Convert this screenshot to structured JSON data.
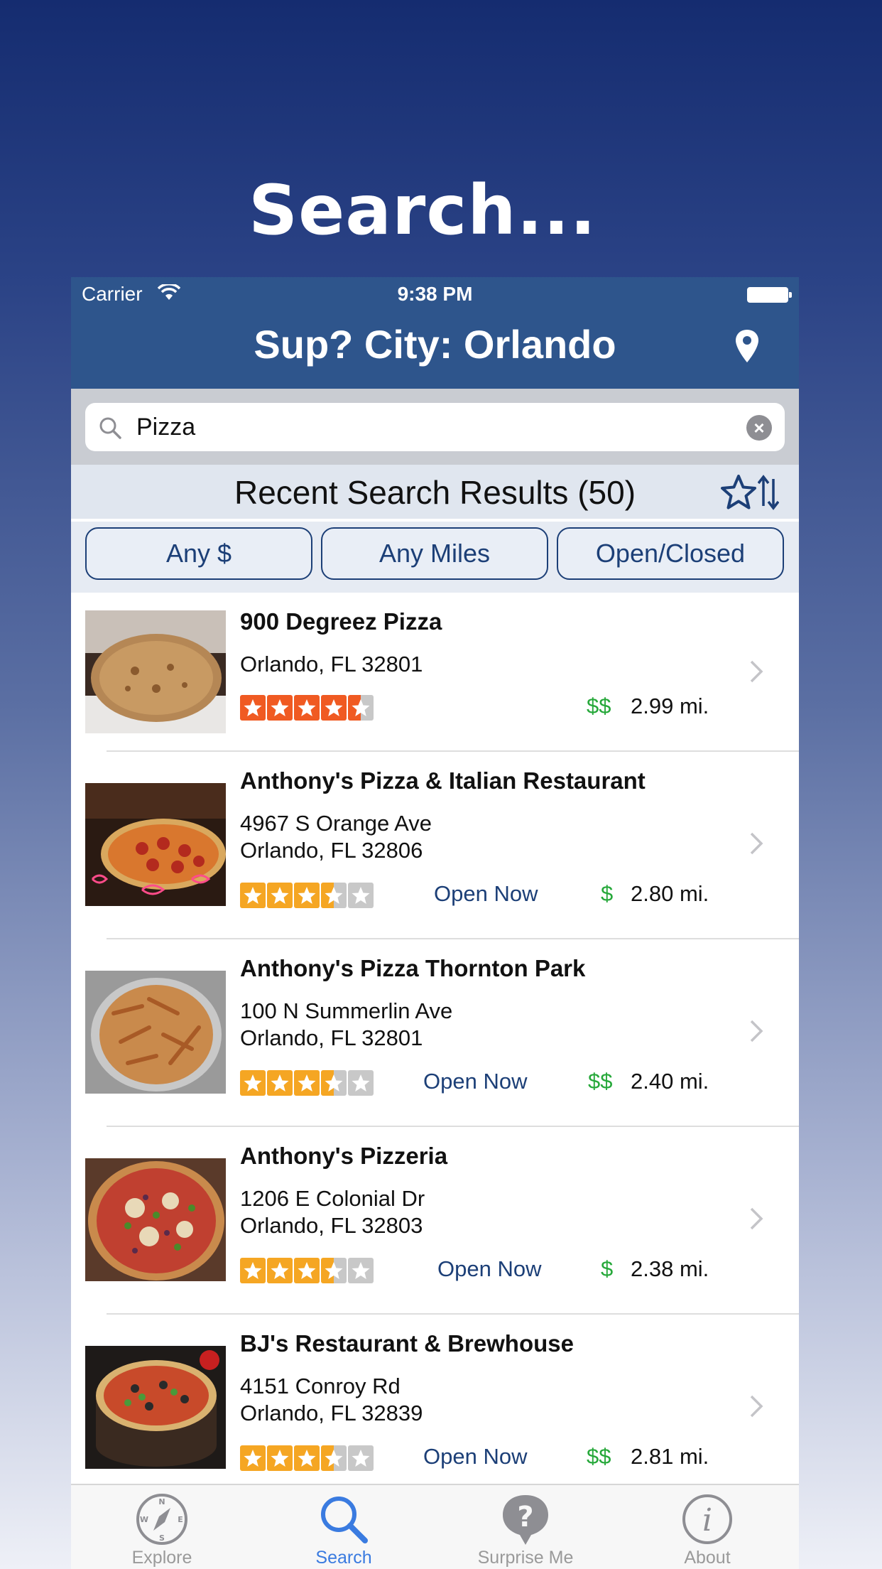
{
  "promo": {
    "title": "Search..."
  },
  "status_bar": {
    "carrier": "Carrier",
    "time": "9:38 PM"
  },
  "nav": {
    "title": "Sup? City:  Orlando",
    "location_icon": "map-pin-icon"
  },
  "search": {
    "value": "Pizza",
    "placeholder": ""
  },
  "results": {
    "title": "Recent Search Results (50)"
  },
  "filters": [
    {
      "label": "Any $"
    },
    {
      "label": "Any Miles"
    },
    {
      "label": "Open/Closed"
    }
  ],
  "restaurants": [
    {
      "name": "900 Degreez Pizza",
      "address_line1": "Orlando, FL 32801",
      "address_line2": "",
      "rating": 4.5,
      "open_status": "",
      "price": "$$",
      "distance": "2.99 mi."
    },
    {
      "name": "Anthony's Pizza & Italian Restaurant",
      "address_line1": "4967 S Orange Ave",
      "address_line2": "Orlando, FL 32806",
      "rating": 3.5,
      "open_status": "Open Now",
      "price": "$",
      "distance": "2.80 mi."
    },
    {
      "name": "Anthony's Pizza Thornton Park",
      "address_line1": "100 N Summerlin Ave",
      "address_line2": "Orlando, FL 32801",
      "rating": 3.5,
      "open_status": "Open Now",
      "price": "$$",
      "distance": "2.40 mi."
    },
    {
      "name": "Anthony's Pizzeria",
      "address_line1": "1206 E Colonial Dr",
      "address_line2": "Orlando, FL 32803",
      "rating": 3.5,
      "open_status": "Open Now",
      "price": "$",
      "distance": "2.38 mi."
    },
    {
      "name": "BJ's Restaurant & Brewhouse",
      "address_line1": "4151 Conroy Rd",
      "address_line2": "Orlando, FL 32839",
      "rating": 3.5,
      "open_status": "Open Now",
      "price": "$$",
      "distance": "2.81 mi."
    }
  ],
  "tabs": [
    {
      "label": "Explore",
      "icon": "compass-icon",
      "active": false
    },
    {
      "label": "Search",
      "icon": "search-icon",
      "active": true
    },
    {
      "label": "Surprise Me",
      "icon": "question-icon",
      "active": false
    },
    {
      "label": "About",
      "icon": "info-icon",
      "active": false
    }
  ],
  "colors": {
    "nav_bar": "#2e558c",
    "accent_blue": "#1c3f77",
    "price_green": "#26a83a",
    "star_high": "#f05a22",
    "star_mid": "#f5a623",
    "star_empty": "#c8c8c8",
    "tab_active": "#3a7be0"
  }
}
